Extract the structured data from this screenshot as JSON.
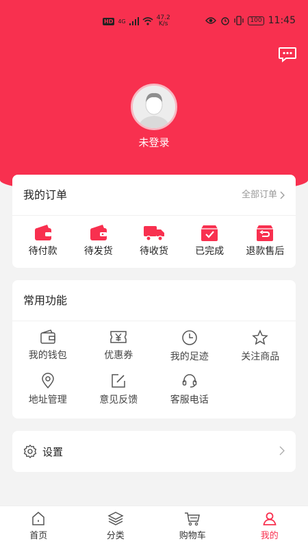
{
  "status_bar": {
    "hd": "HD",
    "signal": "4G",
    "net_speed_value": "47.2",
    "net_speed_unit": "K/s",
    "battery": "100",
    "time": "11:45"
  },
  "profile": {
    "login_text": "未登录"
  },
  "orders": {
    "title": "我的订单",
    "all_label": "全部订单",
    "items": [
      {
        "label": "待付款",
        "icon": "wallet-icon"
      },
      {
        "label": "待发货",
        "icon": "ship-wallet-icon"
      },
      {
        "label": "待收货",
        "icon": "truck-icon"
      },
      {
        "label": "已完成",
        "icon": "box-check-icon"
      },
      {
        "label": "退款售后",
        "icon": "refund-icon"
      }
    ]
  },
  "functions": {
    "title": "常用功能",
    "items": [
      {
        "label": "我的钱包",
        "icon": "wallet-outline-icon"
      },
      {
        "label": "优惠券",
        "icon": "coupon-icon"
      },
      {
        "label": "我的足迹",
        "icon": "clock-icon"
      },
      {
        "label": "关注商品",
        "icon": "star-icon"
      },
      {
        "label": "地址管理",
        "icon": "location-pin-icon"
      },
      {
        "label": "意见反馈",
        "icon": "edit-icon"
      },
      {
        "label": "客服电话",
        "icon": "headset-icon"
      }
    ]
  },
  "settings": {
    "label": "设置"
  },
  "tabbar": {
    "items": [
      {
        "label": "首页",
        "icon": "home-icon"
      },
      {
        "label": "分类",
        "icon": "layers-icon"
      },
      {
        "label": "购物车",
        "icon": "cart-icon"
      },
      {
        "label": "我的",
        "icon": "user-icon"
      }
    ],
    "active_index": 3
  },
  "colors": {
    "accent": "#f8304f",
    "background": "#f3f3f3"
  }
}
